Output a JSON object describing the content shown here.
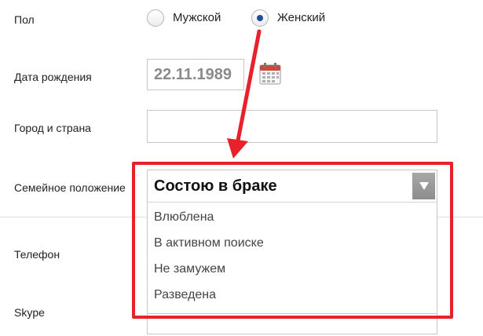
{
  "form": {
    "gender": {
      "label": "Пол",
      "options": [
        {
          "label": "Мужской",
          "checked": false
        },
        {
          "label": "Женский",
          "checked": true
        }
      ]
    },
    "birth_date": {
      "label": "Дата рождения",
      "value": "22.11.1989",
      "icon": "calendar-icon"
    },
    "city": {
      "label": "Город и страна",
      "value": ""
    },
    "marital_status": {
      "label": "Семейное положение",
      "selected": "Состою в браке",
      "options": [
        "Влюблена",
        "В активном поиске",
        "Не замужем",
        "Разведена"
      ]
    },
    "phone": {
      "label": "Телефон"
    },
    "skype": {
      "label": "Skype"
    }
  },
  "colors": {
    "annotation": "#e8212b",
    "radio_checked": "#1f4e9c",
    "calendar_accent": "#c94a3d"
  }
}
